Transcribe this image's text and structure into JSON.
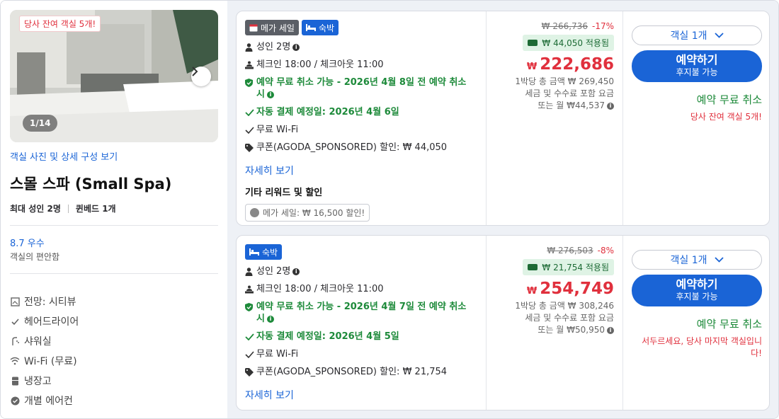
{
  "room": {
    "remaining_tag": "당사 잔여 객실 5개!",
    "photo_counter": "1/14",
    "photo_link": "객실 사진 및 상세 구성 보기",
    "name": "스몰 스파 (Small Spa)",
    "capacity": "최대 성인 2명",
    "bed": "퀸베드 1개",
    "score": "8.7 우수",
    "score_sub": "객실의 편안함",
    "amenities": [
      {
        "icon": "view-icon",
        "label": "전망: 시티뷰"
      },
      {
        "icon": "hairdryer-icon",
        "label": "헤어드라이어"
      },
      {
        "icon": "shower-icon",
        "label": "샤워실"
      },
      {
        "icon": "wifi-icon",
        "label": "Wi-Fi (무료)"
      },
      {
        "icon": "fridge-icon",
        "label": "냉장고"
      },
      {
        "icon": "aircon-icon",
        "label": "개별 에어컨"
      }
    ]
  },
  "offers": [
    {
      "badge_mega": "메가 세일",
      "badge_stay": "숙박",
      "guests": "성인 2명",
      "checkin": "체크인 18:00 / 체크아웃 11:00",
      "free_cancel": "예약 무료 취소 가능 - 2026년 4월 8일 전 예약 취소 시",
      "auto_pay": "자동 결제 예정일: 2026년 4월 6일",
      "wifi": "무료 Wi-Fi",
      "coupon": "쿠폰(AGODA_SPONSORED) 할인: ₩ 44,050",
      "more": "자세히 보기",
      "rewards_title": "기타 리워드 및 할인",
      "promo_chip": "메가 세일: ₩ 16,500 할인!",
      "old_price": "₩ 266,736",
      "discount_pct": "-17%",
      "coupon_applied": "₩ 44,050 적용됨",
      "currency": "₩",
      "price": "222,686",
      "note1": "1박당 총 금액 ₩ 269,450",
      "note2": "세금 및 수수료 포함 요금",
      "note3": "또는 월 ₩44,537",
      "rooms_select": "객실 1개",
      "book": "예약하기",
      "book_sub": "후지불 가능",
      "cancel_text": "예약 무료 취소",
      "avail_note": "당사 잔여 객실 5개!"
    },
    {
      "badge_stay": "숙박",
      "guests": "성인 2명",
      "checkin": "체크인 18:00 / 체크아웃 11:00",
      "free_cancel": "예약 무료 취소 가능 - 2026년 4월 7일 전 예약 취소 시",
      "auto_pay": "자동 결제 예정일: 2026년 4월 5일",
      "wifi": "무료 Wi-Fi",
      "coupon": "쿠폰(AGODA_SPONSORED) 할인: ₩ 21,754",
      "more": "자세히 보기",
      "old_price": "₩ 276,503",
      "discount_pct": "-8%",
      "coupon_applied": "₩ 21,754 적용됨",
      "currency": "₩",
      "price": "254,749",
      "note1": "1박당 총 금액 ₩ 308,246",
      "note2": "세금 및 수수료 포함 요금",
      "note3": "또는 월 ₩50,950",
      "rooms_select": "객실 1개",
      "book": "예약하기",
      "book_sub": "후지불 가능",
      "cancel_text": "예약 무료 취소",
      "avail_note": "서두르세요, 당사 마지막 객실입니다!"
    }
  ],
  "colors": {
    "accent_blue": "#1a64d6",
    "price_red": "#e0303d",
    "green": "#1d8a3a"
  }
}
